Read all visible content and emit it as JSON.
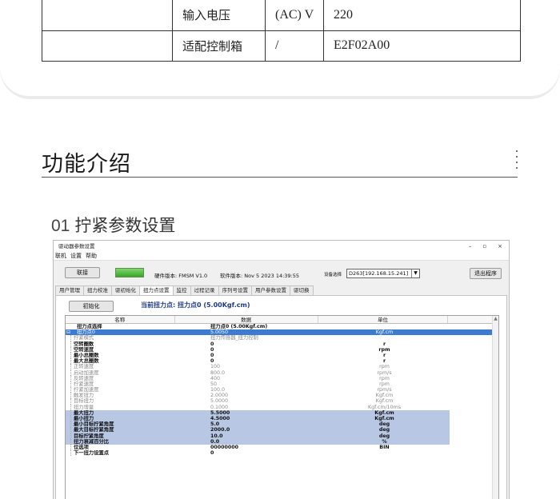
{
  "spec_table": [
    {
      "label": "输入电压",
      "unit": "(AC) V",
      "value": "220"
    },
    {
      "label": "适配控制箱",
      "unit": "/",
      "value": "E2F02A00"
    }
  ],
  "section_title": "功能介绍",
  "sub_title": {
    "num": "01",
    "text": "拧紧参数设置"
  },
  "app": {
    "window_title": "驱动器参数设置",
    "controls": {
      "min": "–",
      "max": "▫",
      "close": "×"
    },
    "menu": [
      "联机",
      "设置",
      "帮助"
    ],
    "connect_button": "联接",
    "hardware_version": "硬件版本: FMSM V1.0",
    "software_version": "软件版本: Nov  5 2023 14:39:55",
    "device_label": "设备选择",
    "device_value": "D263[192.168.15.241]",
    "exit_button": "退出程序",
    "tabs": [
      "用户管理",
      "扭力校准",
      "驱初始化",
      "扭力点设置",
      "监控",
      "过程记录",
      "序列号设置",
      "用户参数设置",
      "驱切换"
    ],
    "active_tab": "扭力点设置",
    "init_button": "初始化",
    "current_point": "当前扭力点: 扭力点0 (5.00Kgf.cm)",
    "grid_headers": [
      "名称",
      "数据",
      "单位"
    ],
    "rows": [
      {
        "name": "扭力点选择",
        "value": "扭力点0 (5.00Kgf.cm)",
        "unit": "",
        "style": "top bold"
      },
      {
        "name": "扭力点0",
        "value": "5.0050",
        "unit": "Kgf.cm",
        "style": "hl-dark top"
      },
      {
        "name": "拧紧模式",
        "value": "扭力传感器_扭力控制",
        "unit": "",
        "style": "grey"
      },
      {
        "name": "空转圈数",
        "value": "0",
        "unit": "r",
        "style": "bold"
      },
      {
        "name": "空转速度",
        "value": "0",
        "unit": "rpm",
        "style": "bold"
      },
      {
        "name": "最小总圈数",
        "value": "0",
        "unit": "r",
        "style": "bold"
      },
      {
        "name": "最大总圈数",
        "value": "0",
        "unit": "r",
        "style": "bold"
      },
      {
        "name": "正转速度",
        "value": "100",
        "unit": "rpm",
        "style": "grey"
      },
      {
        "name": "启动加速度",
        "value": "800.0",
        "unit": "rpm/s",
        "style": "grey"
      },
      {
        "name": "反转速度",
        "value": "400",
        "unit": "rpm",
        "style": "grey"
      },
      {
        "name": "拧紧速度",
        "value": "50",
        "unit": "rpm",
        "style": "grey"
      },
      {
        "name": "拧紧加速度",
        "value": "100.0",
        "unit": "rpm/s",
        "style": "grey"
      },
      {
        "name": "触发扭力",
        "value": "2.0000",
        "unit": "Kgf.cm",
        "style": "grey"
      },
      {
        "name": "目标扭力",
        "value": "5.0000",
        "unit": "Kgf.cm",
        "style": "grey"
      },
      {
        "name": "扭力增量",
        "value": "0.1000",
        "unit": "Kgf.cm/10ms",
        "style": "grey"
      },
      {
        "name": "最大扭力",
        "value": "5.5000",
        "unit": "Kgf.cm",
        "style": "hl-light bold"
      },
      {
        "name": "最小扭力",
        "value": "4.5000",
        "unit": "Kgf.cm",
        "style": "hl-light bold"
      },
      {
        "name": "最小目标拧紧角度",
        "value": "5.0",
        "unit": "deg",
        "style": "hl-light bold"
      },
      {
        "name": "最大目标拧紧角度",
        "value": "2000.0",
        "unit": "deg",
        "style": "hl-light bold"
      },
      {
        "name": "目标拧紧角度",
        "value": "10.0",
        "unit": "deg",
        "style": "hl-light bold"
      },
      {
        "name": "扭力衰减百分比",
        "value": "0.0",
        "unit": "%",
        "style": "hl-light bold"
      },
      {
        "name": "位选项",
        "value": "00000000",
        "unit": "BIN",
        "style": "bold"
      },
      {
        "name": "下一扭力设置点",
        "value": "0",
        "unit": "",
        "style": "bold"
      }
    ]
  }
}
